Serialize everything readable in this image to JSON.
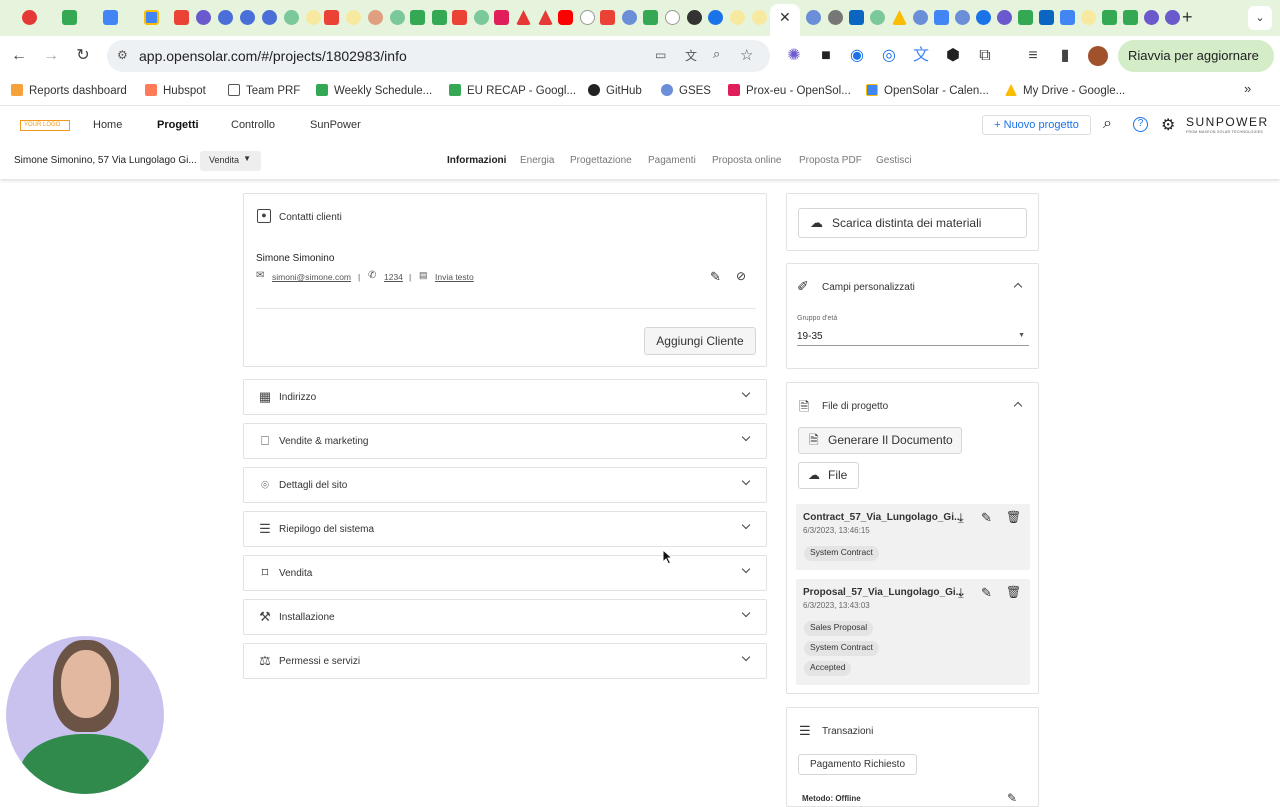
{
  "browser": {
    "url": "app.opensolar.com/#/projects/1802983/info",
    "relaunch_label": "Riavvia per aggiornare",
    "bookmarks": [
      "Reports dashboard",
      "Hubspot",
      "Team PRF",
      "Weekly Schedule...",
      "EU RECAP - Googl...",
      "GitHub",
      "GSES",
      "Prox-eu - OpenSol...",
      "OpenSolar - Calen...",
      "My Drive - Google..."
    ]
  },
  "app": {
    "logo_text": "YOUR LOGO",
    "nav": [
      "Home",
      "Progetti",
      "Controllo",
      "SunPower"
    ],
    "new_project_label": "+ Nuovo progetto",
    "brand": "SUNPOWER",
    "brand_sub": "FROM MAXEON SOLAR TECHNOLOGIES"
  },
  "project": {
    "title": "Simone Simonino, 57 Via Lungolago Gi...",
    "stage": "Vendita",
    "tabs": [
      "Informazioni",
      "Energia",
      "Progettazione",
      "Pagamenti",
      "Proposta online",
      "Proposta PDF",
      "Gestisci"
    ]
  },
  "contacts": {
    "title": "Contatti clienti",
    "name": "Simone Simonino",
    "email": "simoni@simone.com",
    "phone": "1234",
    "sms": "Invia testo",
    "add_button": "Aggiungi Cliente"
  },
  "accordions": [
    "Indirizzo",
    "Vendite & marketing",
    "Dettagli del sito",
    "Riepilogo del sistema",
    "Vendita",
    "Installazione",
    "Permessi e servizi"
  ],
  "sidebar": {
    "bom_button": "Scarica distinta dei materiali",
    "custom_fields": {
      "title": "Campi personalizzati",
      "field_label": "Gruppo d'età",
      "field_value": "19-35"
    },
    "files": {
      "title": "File di progetto",
      "generate_button": "Generare Il Documento",
      "file_button": "File",
      "items": [
        {
          "name": "Contract_57_Via_Lungolago_Gi...",
          "date": "6/3/2023, 13:46:15",
          "tags": [
            "System Contract"
          ]
        },
        {
          "name": "Proposal_57_Via_Lungolago_Gi...",
          "date": "6/3/2023, 13:43:03",
          "tags": [
            "Sales Proposal",
            "System Contract",
            "Accepted"
          ]
        }
      ]
    },
    "transactions": {
      "title": "Transazioni",
      "button": "Pagamento Richiesto",
      "method": "Metodo: Offline"
    }
  },
  "colors": {
    "tabstrip": "#e6f4dd",
    "accent": "#1a73e8",
    "orange": "#f29a1f"
  }
}
